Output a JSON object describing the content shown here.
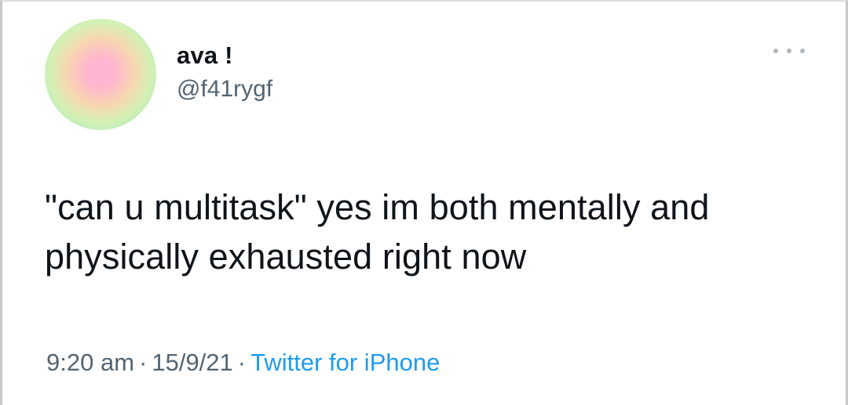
{
  "tweet": {
    "display_name": "ava !",
    "handle": "@f41rygf",
    "text": "\"can u multitask\" yes im both mentally and physically exhausted right now",
    "time": "9:20 am",
    "date": "15/9/21",
    "separator": "·",
    "source": "Twitter for iPhone"
  },
  "icons": {
    "avatar": "gradient-avatar",
    "more": "more-horizontal-icon"
  },
  "colors": {
    "text": "#0f1419",
    "secondary": "#536471",
    "link": "#1d9bf0"
  }
}
